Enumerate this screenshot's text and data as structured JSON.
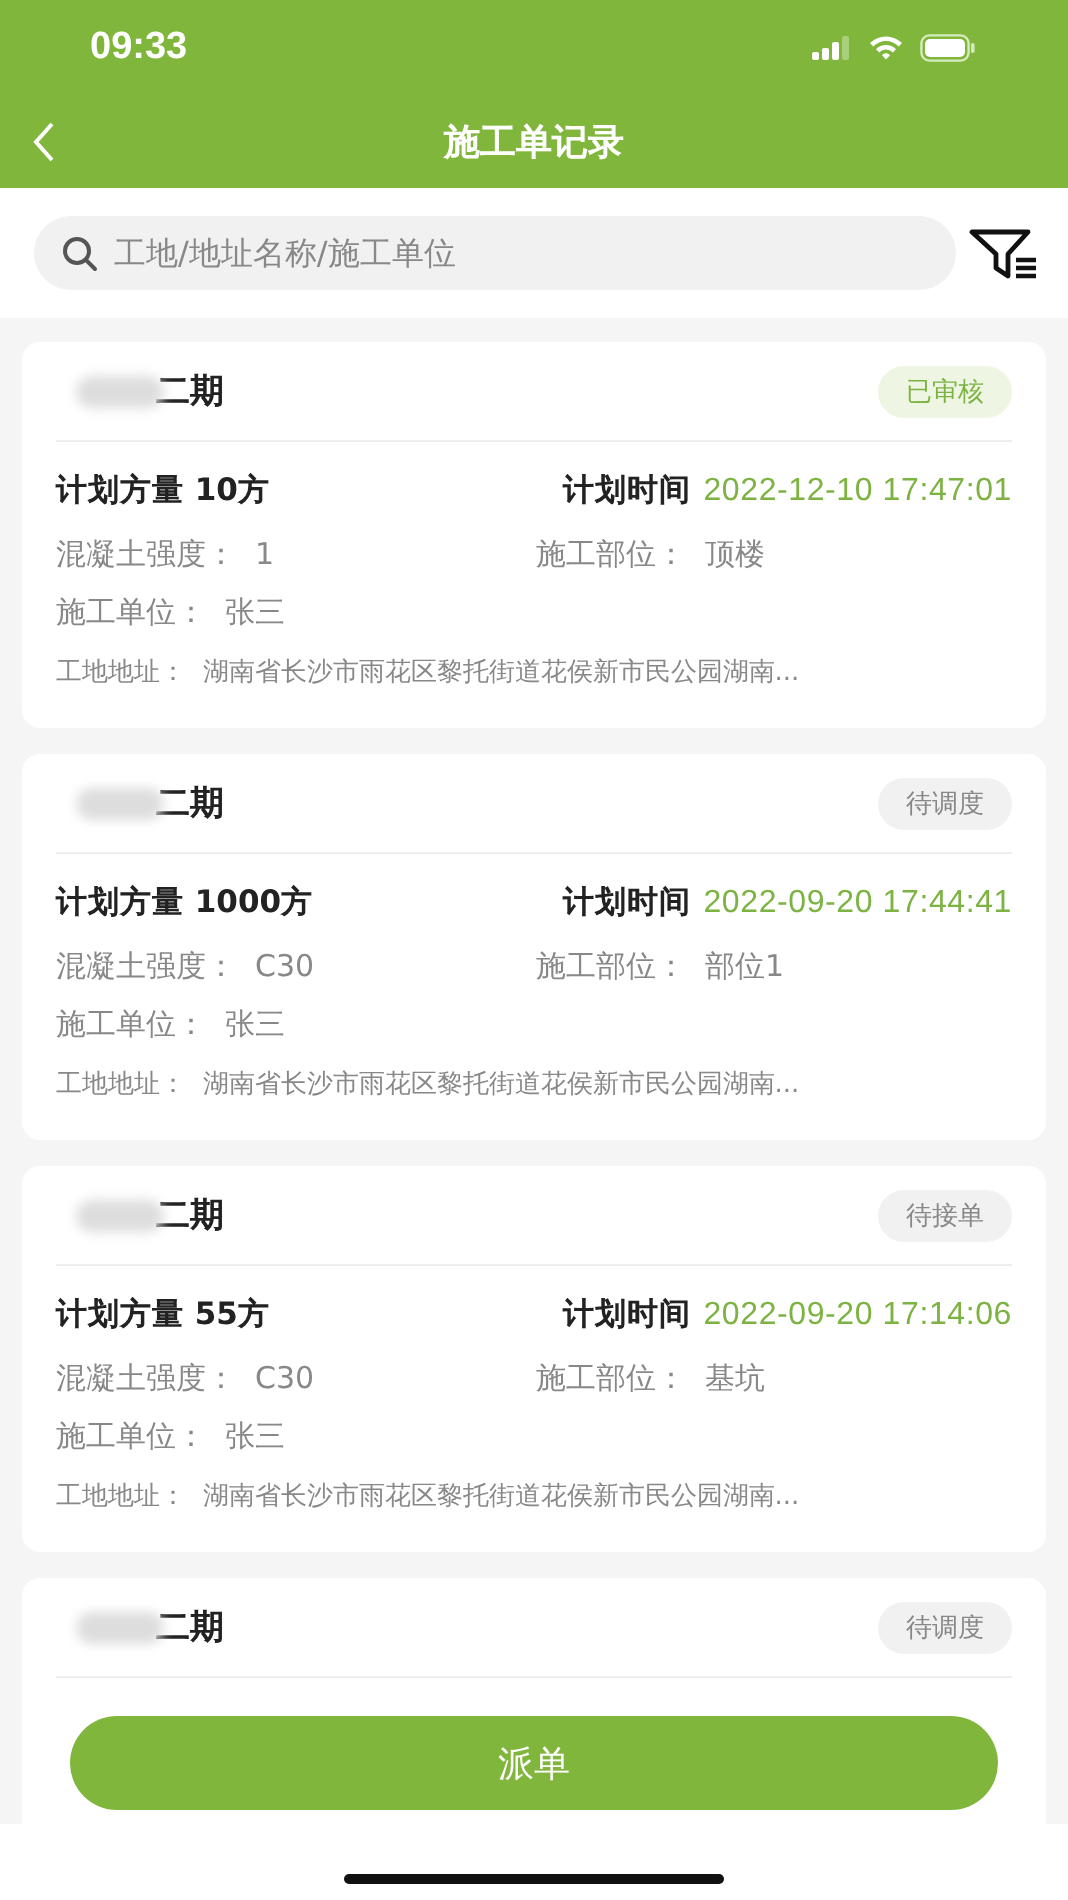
{
  "status_bar": {
    "time": "09:33"
  },
  "header": {
    "title": "施工单记录"
  },
  "search": {
    "placeholder": "工地/地址名称/施工单位"
  },
  "orders": [
    {
      "title": "二期",
      "status": {
        "label": "已审核",
        "kind": "approved"
      },
      "quantity": "计划方量 10方",
      "time_label": "计划时间",
      "time": "2022-12-10 17:47:01",
      "strength": "混凝土强度：  1",
      "part": "施工部位：  顶楼",
      "unit": "施工单位：  张三",
      "address": "工地地址：  湖南省长沙市雨花区黎托街道花侯新市民公园湖南..."
    },
    {
      "title": "二期",
      "status": {
        "label": "待调度",
        "kind": "pending"
      },
      "quantity": "计划方量 1000方",
      "time_label": "计划时间",
      "time": "2022-09-20 17:44:41",
      "strength": "混凝土强度：  C30",
      "part": "施工部位：  部位1",
      "unit": "施工单位：  张三",
      "address": "工地地址：  湖南省长沙市雨花区黎托街道花侯新市民公园湖南..."
    },
    {
      "title": "二期",
      "status": {
        "label": "待接单",
        "kind": "pending"
      },
      "quantity": "计划方量 55方",
      "time_label": "计划时间",
      "time": "2022-09-20 17:14:06",
      "strength": "混凝土强度：  C30",
      "part": "施工部位：  基坑",
      "unit": "施工单位：  张三",
      "address": "工地地址：  湖南省长沙市雨花区黎托街道花侯新市民公园湖南..."
    },
    {
      "title": "二期",
      "status": {
        "label": "待调度",
        "kind": "pending"
      }
    }
  ],
  "action_button": {
    "label": "派单"
  }
}
